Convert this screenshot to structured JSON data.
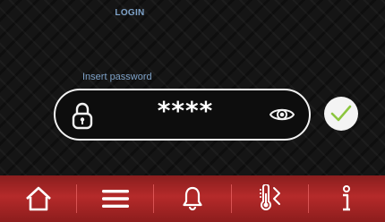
{
  "header": {
    "title": "LOGIN"
  },
  "login": {
    "password_label": "Insert password",
    "password_value": "****"
  },
  "colors": {
    "accent_text": "#7fa3c9",
    "confirm_check": "#8cc63f",
    "nav_bar": "#b52a2a"
  },
  "nav": {
    "items": [
      {
        "icon": "home-icon"
      },
      {
        "icon": "menu-icon"
      },
      {
        "icon": "bell-icon"
      },
      {
        "icon": "thermometer-icon"
      },
      {
        "icon": "info-icon"
      }
    ]
  }
}
